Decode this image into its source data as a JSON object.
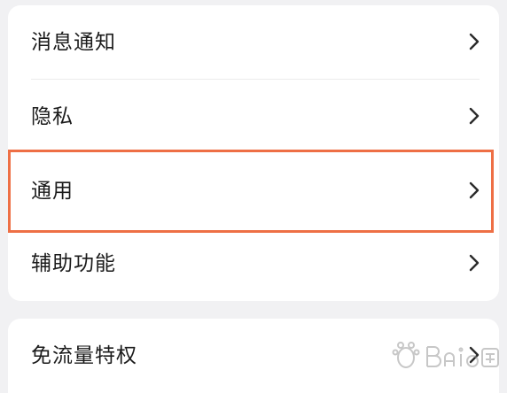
{
  "settings": {
    "group1": [
      {
        "label": "消息通知"
      },
      {
        "label": "隐私"
      },
      {
        "label": "通用"
      },
      {
        "label": "辅助功能"
      }
    ],
    "group2": [
      {
        "label": "免流量特权"
      }
    ]
  },
  "annotation": {
    "highlight_color": "#ee6f45",
    "highlighted_item": "通用"
  },
  "icons": {
    "chevron": "chevron-right-icon"
  },
  "colors": {
    "background": "#f1f1f3",
    "card": "#ffffff",
    "text": "#1b1b1b",
    "chevron": "#2a2a2a"
  }
}
